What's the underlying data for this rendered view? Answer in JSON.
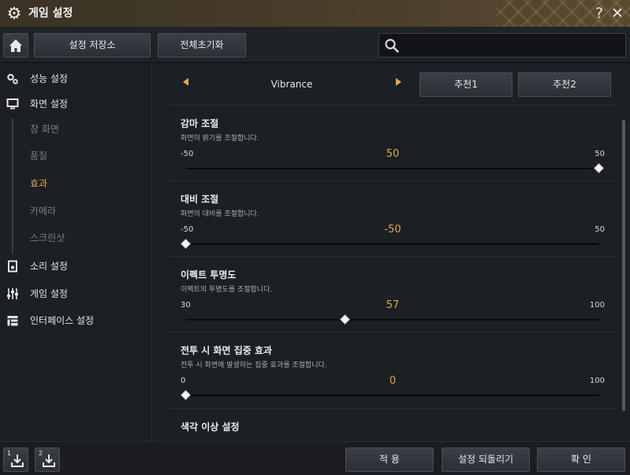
{
  "window": {
    "title": "게임 설정",
    "help_label": "?",
    "close_label": "✕"
  },
  "toolbar": {
    "store_label": "설정 저장소",
    "reset_label": "전체초기화",
    "search_placeholder": ""
  },
  "sidebar": {
    "items": [
      {
        "label": "성능 설정",
        "icon": "gears-icon"
      },
      {
        "label": "화면 설정",
        "icon": "monitor-icon"
      },
      {
        "label": "소리 설정",
        "icon": "speaker-icon"
      },
      {
        "label": "게임 설정",
        "icon": "sliders-icon"
      },
      {
        "label": "인터페이스 설정",
        "icon": "interface-icon"
      }
    ],
    "sub_items": [
      {
        "label": "창 화면",
        "active": false
      },
      {
        "label": "품질",
        "active": false
      },
      {
        "label": "효과",
        "active": true
      },
      {
        "label": "카메라",
        "active": false
      },
      {
        "label": "스크린샷",
        "active": false
      }
    ],
    "active_color": "#e2a849"
  },
  "preset": {
    "name": "Vibrance",
    "rec1_label": "추천1",
    "rec2_label": "추천2"
  },
  "settings": [
    {
      "title": "감마 조절",
      "desc": "화면의 밝기를 조절합니다.",
      "min": "-50",
      "max": "50",
      "value": "50",
      "fraction": 1.0
    },
    {
      "title": "대비 조절",
      "desc": "화면의 대비를 조절합니다.",
      "min": "-50",
      "max": "50",
      "value": "-50",
      "fraction": 0.0
    },
    {
      "title": "이펙트 투명도",
      "desc": "이펙트의 투명도를 조절합니다.",
      "min": "30",
      "max": "100",
      "value": "57",
      "fraction": 0.386
    },
    {
      "title": "전투 시 화면 집중 효과",
      "desc": "전투 시 화면에 발생하는 집중 효과를 조절합니다.",
      "min": "0",
      "max": "100",
      "value": "0",
      "fraction": 0.0
    },
    {
      "title": "색각 이상 설정"
    }
  ],
  "footer": {
    "slot1_label": "1",
    "slot2_label": "2",
    "apply_label": "적 용",
    "revert_label": "설정 되돌리기",
    "confirm_label": "확 인"
  },
  "colors": {
    "accent": "#e2a849",
    "title_bar": "#4a3e2a"
  }
}
